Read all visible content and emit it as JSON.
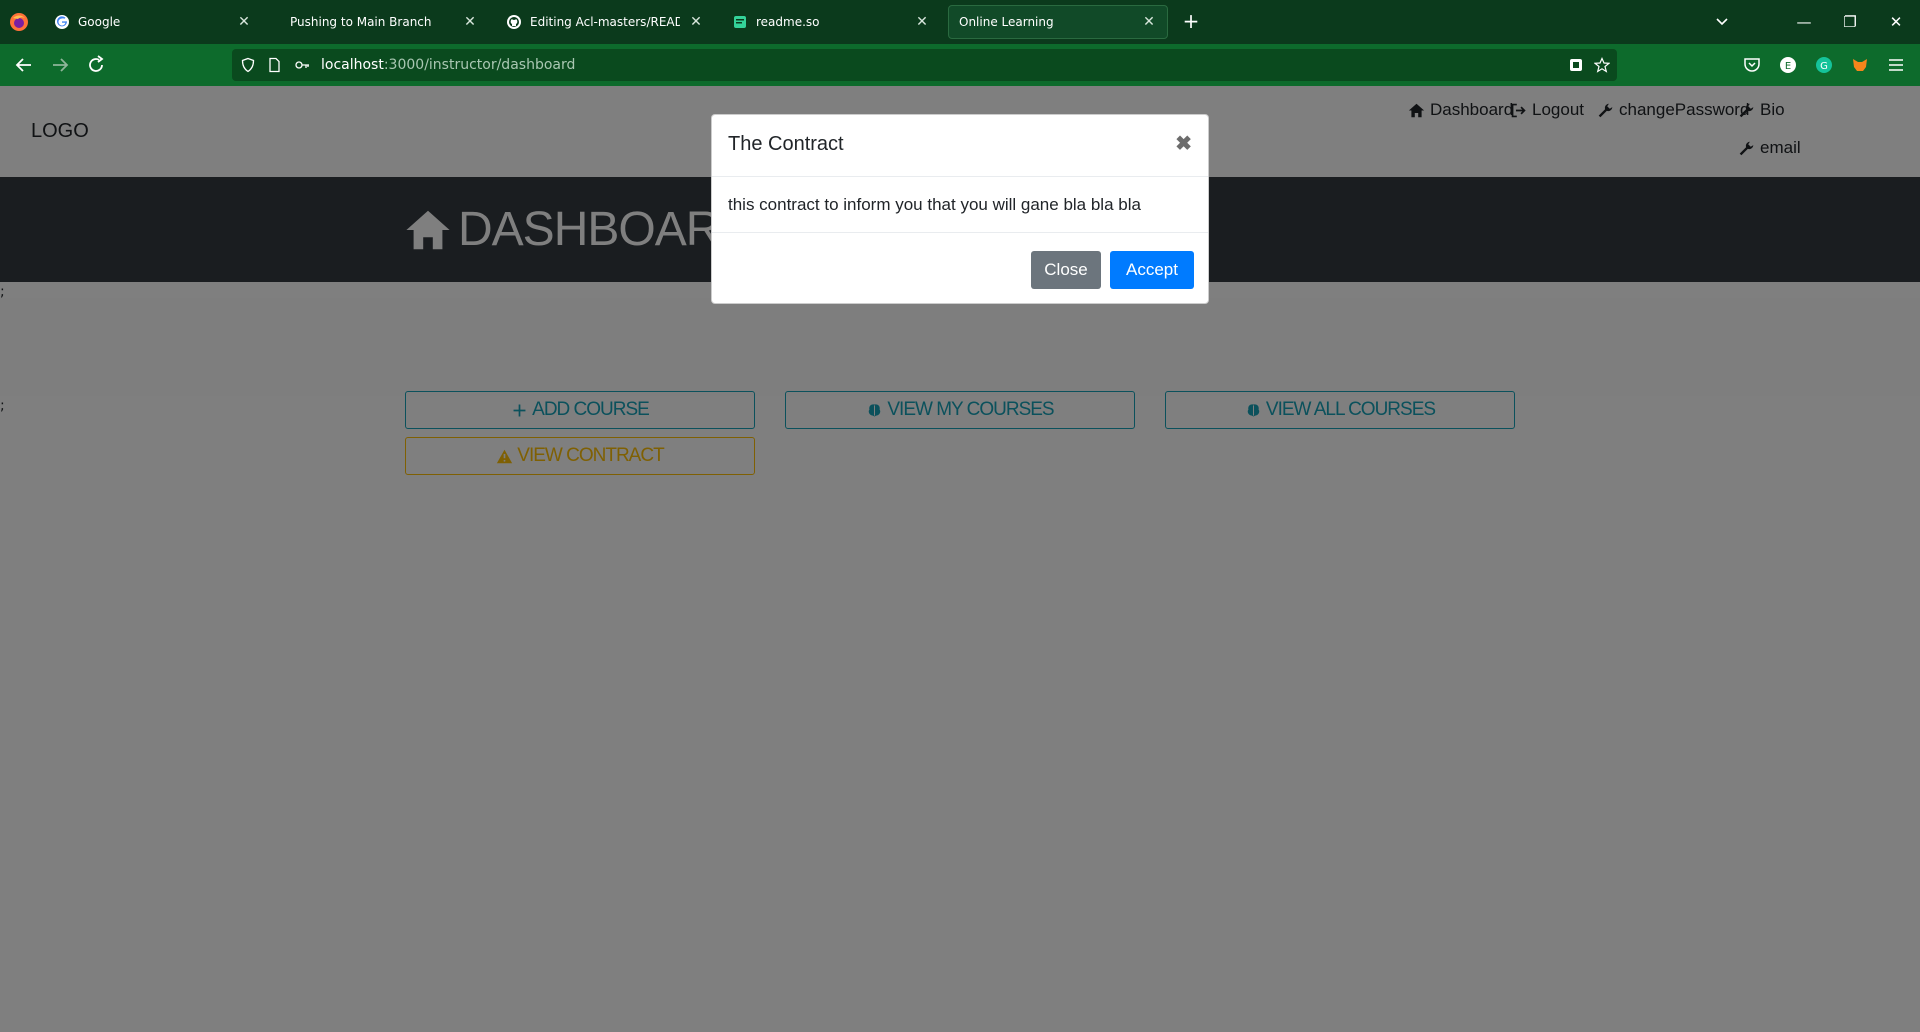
{
  "browser": {
    "tabs": [
      {
        "title": "Google",
        "favicon": "google-icon"
      },
      {
        "title": "Pushing to Main Branch",
        "favicon": "none"
      },
      {
        "title": "Editing Acl-masters/README.m",
        "favicon": "github-icon"
      },
      {
        "title": "readme.so",
        "favicon": "readme-icon"
      },
      {
        "title": "Online Learning",
        "favicon": "none",
        "active": true
      }
    ],
    "url_host": "localhost",
    "url_rest": ":3000/instructor/dashboard"
  },
  "header": {
    "logo": "LOGO",
    "links": {
      "dashboard": "Dashboard",
      "logout": "Logout",
      "change_password": "changePassword",
      "bio": "Bio",
      "email": "email"
    }
  },
  "hero": {
    "title": "DASHBOARD"
  },
  "artifacts": {
    "semicolon": ";"
  },
  "actions": {
    "add_course": "ADD COURSE",
    "view_my_courses": "VIEW MY COURSES",
    "view_all_courses": "VIEW ALL COURSES",
    "view_contract": "VIEW CONTRACT"
  },
  "modal": {
    "title": "The Contract",
    "close_symbol": "✖",
    "body": "this contract to inform you that you will gane bla bla bla",
    "close_label": "Close",
    "accept_label": "Accept"
  },
  "colors": {
    "tabbar": "#0b3a1c",
    "navbar": "#0d6b2c",
    "hero": "#343a40",
    "info": "#17a2b8",
    "warning": "#ffc107",
    "primary": "#007bff",
    "secondary": "#6c757d"
  }
}
